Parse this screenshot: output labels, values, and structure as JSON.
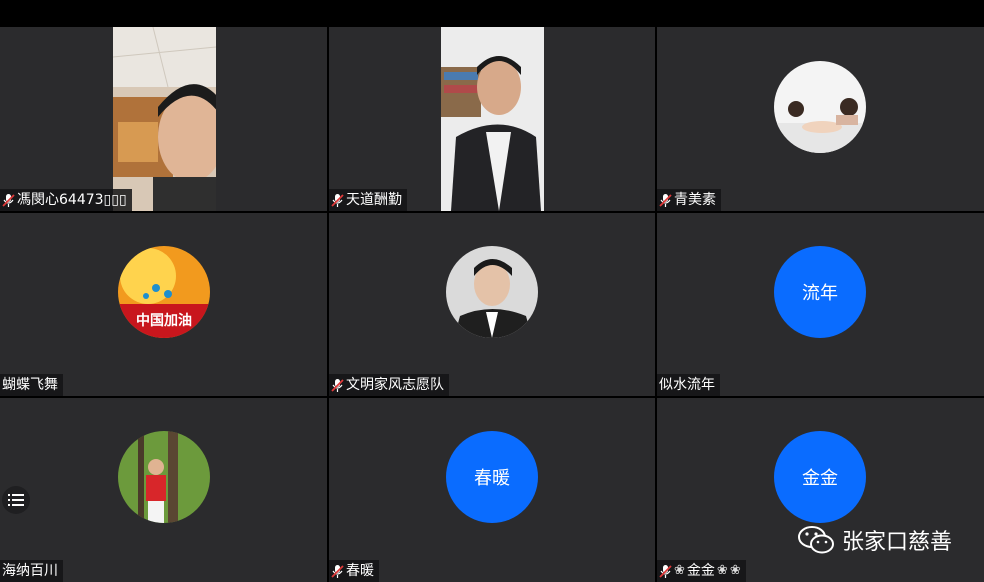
{
  "participants": [
    {
      "name": "馮閔心64473▯▯▯",
      "type": "video",
      "muted": true
    },
    {
      "name": "天道酬勤",
      "type": "video",
      "muted": true
    },
    {
      "name": "青美素",
      "type": "photo",
      "muted": true
    },
    {
      "name": "蝴蝶飞舞",
      "type": "photo",
      "muted": false,
      "avatar_text": "中国加油"
    },
    {
      "name": "文明家风志愿队",
      "type": "photo",
      "muted": true
    },
    {
      "name": "似水流年",
      "type": "text",
      "muted": false,
      "avatar_text": "流年"
    },
    {
      "name": "海纳百川",
      "type": "photo",
      "muted": false
    },
    {
      "name": "春暖",
      "type": "text",
      "muted": true,
      "avatar_text": "春暖"
    },
    {
      "name": "金金",
      "type": "text",
      "muted": true,
      "avatar_text": "金金"
    }
  ],
  "watermark": {
    "text": "张家口慈善"
  },
  "colors": {
    "tile_bg": "#2b2b2d",
    "avatar_blue": "#0a6cff",
    "mic_muted": "#e03a3a"
  }
}
